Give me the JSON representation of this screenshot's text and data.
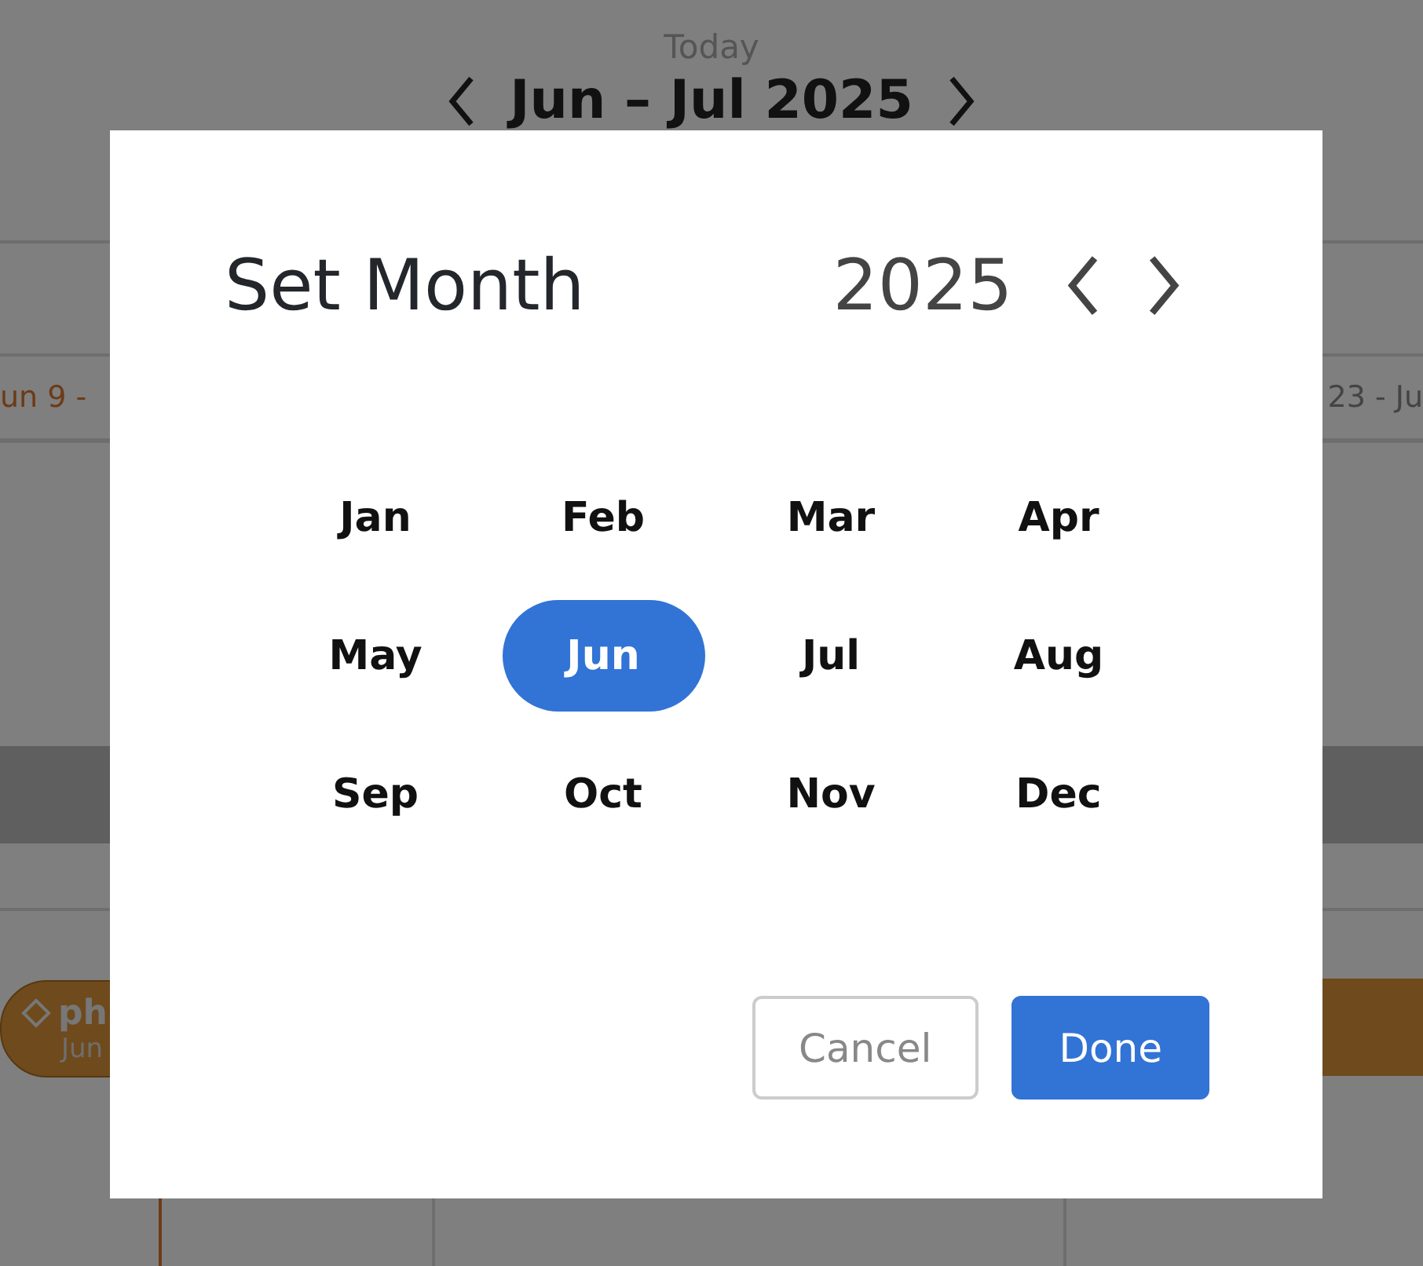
{
  "calendar": {
    "today_label": "Today",
    "range_title": "Jun – Jul 2025",
    "week_labels": [
      {
        "label": "un 9 -",
        "current": true
      },
      {
        "label": "23 - Ju",
        "current": false
      }
    ],
    "task_bar": {
      "title": "ph",
      "dates": "Jun"
    }
  },
  "dialog": {
    "title": "Set Month",
    "year": "2025",
    "months": [
      {
        "label": "Jan",
        "selected": false
      },
      {
        "label": "Feb",
        "selected": false
      },
      {
        "label": "Mar",
        "selected": false
      },
      {
        "label": "Apr",
        "selected": false
      },
      {
        "label": "May",
        "selected": false
      },
      {
        "label": "Jun",
        "selected": true
      },
      {
        "label": "Jul",
        "selected": false
      },
      {
        "label": "Aug",
        "selected": false
      },
      {
        "label": "Sep",
        "selected": false
      },
      {
        "label": "Oct",
        "selected": false
      },
      {
        "label": "Nov",
        "selected": false
      },
      {
        "label": "Dec",
        "selected": false
      }
    ],
    "buttons": [
      {
        "label": "Cancel",
        "kind": "secondary"
      },
      {
        "label": "Done",
        "kind": "primary"
      }
    ]
  }
}
